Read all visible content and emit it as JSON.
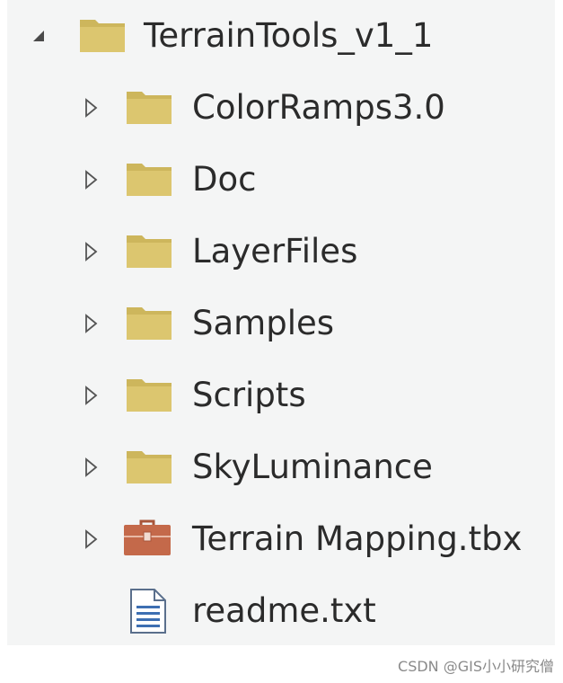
{
  "tree": {
    "root": {
      "label": "TerrainTools_v1_1",
      "icon": "folder-icon",
      "expanded": true
    },
    "children": [
      {
        "label": "ColorRamps3.0",
        "icon": "folder-icon",
        "expandable": true
      },
      {
        "label": "Doc",
        "icon": "folder-icon",
        "expandable": true
      },
      {
        "label": "LayerFiles",
        "icon": "folder-icon",
        "expandable": true
      },
      {
        "label": "Samples",
        "icon": "folder-icon",
        "expandable": true
      },
      {
        "label": "Scripts",
        "icon": "folder-icon",
        "expandable": true
      },
      {
        "label": "SkyLuminance",
        "icon": "folder-icon",
        "expandable": true
      },
      {
        "label": "Terrain Mapping.tbx",
        "icon": "toolbox-icon",
        "expandable": true
      },
      {
        "label": "readme.txt",
        "icon": "text-file-icon",
        "expandable": false
      }
    ]
  },
  "colors": {
    "folder": "#dcc66f",
    "folder_tab": "#cdb65c",
    "toolbox": "#c4694a",
    "text_file": "#3d6fb2",
    "label": "#2b2b2b",
    "panel_bg": "#f4f5f5"
  },
  "watermark": "CSDN @GIS小小研究僧"
}
